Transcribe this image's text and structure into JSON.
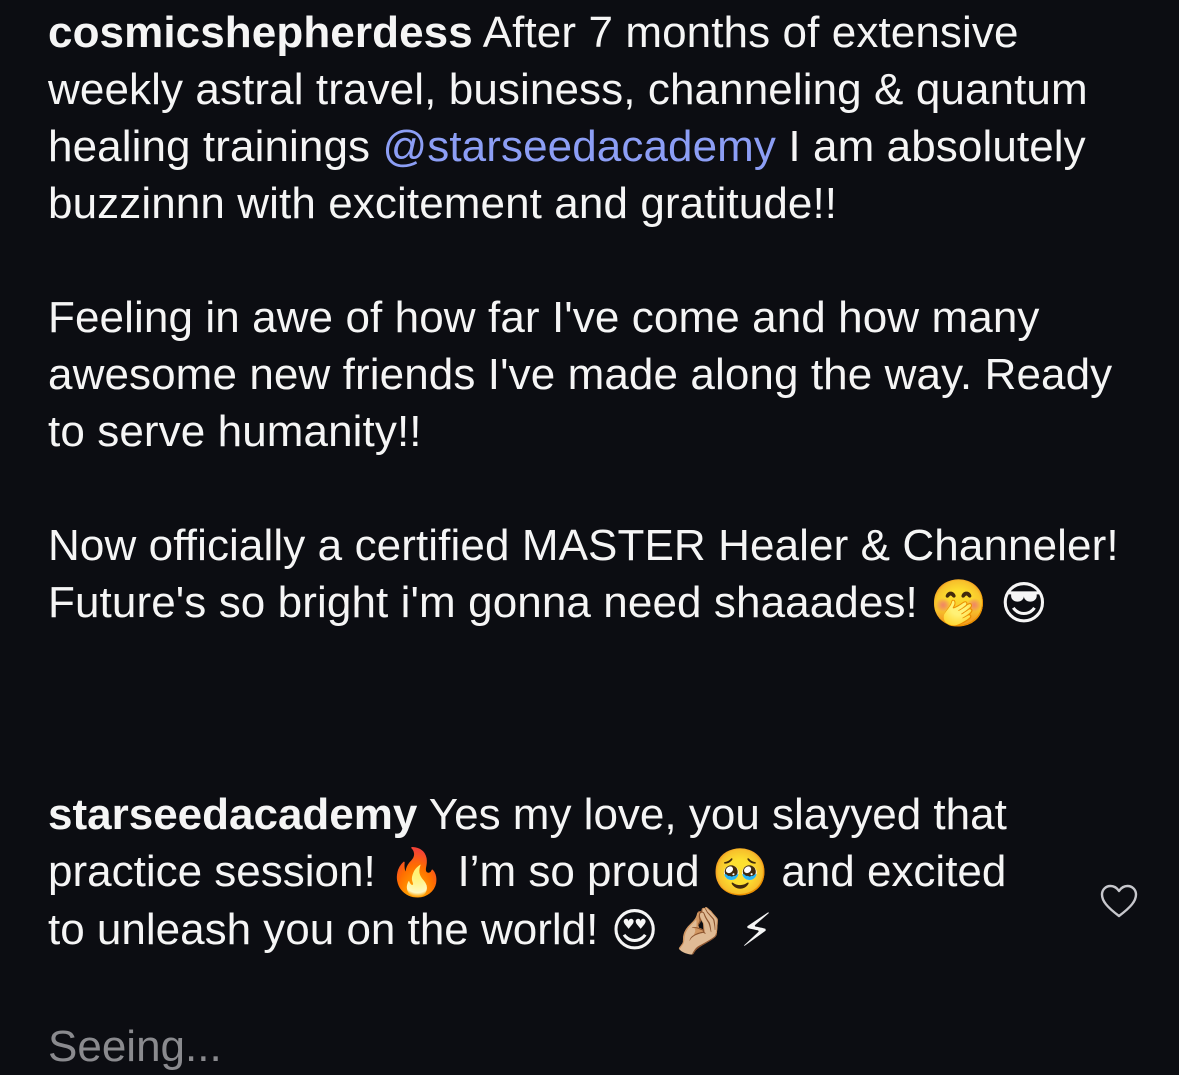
{
  "post": {
    "author": "cosmicshepherdess",
    "para1_text": "After 7 months of extensive weekly astral travel, business, channeling & quantum healing trainings",
    "mention": "@starseedacademy",
    "para1_tail": "I am absolutely buzzinnn with excitement and gratitude!!",
    "para2": "Feeling in awe of how far I've come and how many awesome new friends I've made along the way. Ready to serve humanity!!",
    "para3": "Now officially a certified MASTER Healer & Channeler! Future's so bright i'm gonna need shaaades!",
    "para3_emoji_1": "🤭",
    "para3_emoji_2": "😎"
  },
  "reply": {
    "author": "starseedacademy",
    "text_1": "Yes my love, you slayyed that practice session!",
    "emoji_fire": "🔥",
    "text_2": "I’m so proud",
    "emoji_pleading": "🥹",
    "text_3": "and excited to unleash you on the world!",
    "emoji_heart_eyes": "😍",
    "emoji_pinch": "🤌🏼",
    "emoji_zap": "⚡"
  },
  "next_comment_partial": "Seeing..."
}
